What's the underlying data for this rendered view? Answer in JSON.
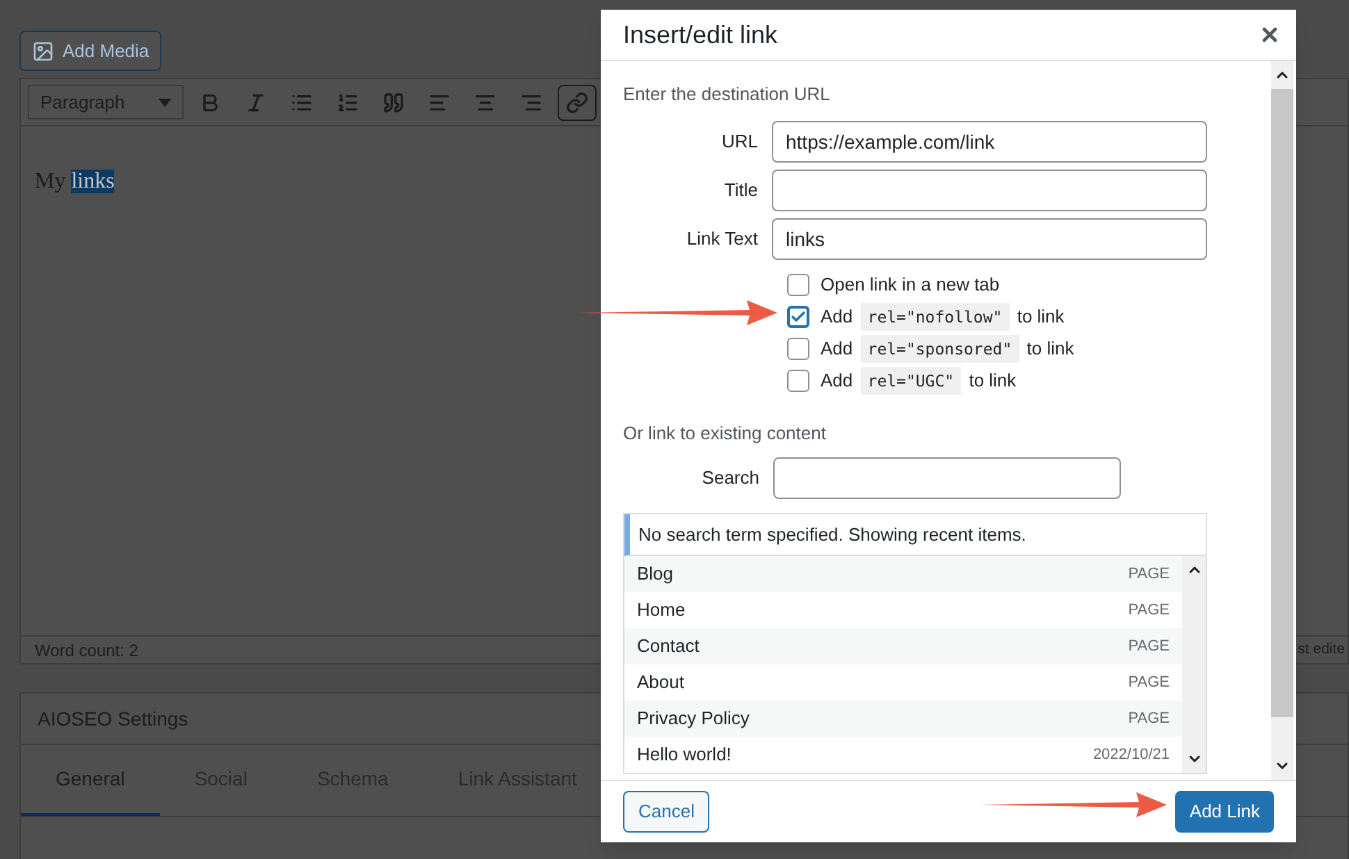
{
  "editor": {
    "add_media": "Add Media",
    "format_select": "Paragraph",
    "toolbar": [
      {
        "kind": "bold",
        "selected": false
      },
      {
        "kind": "italic",
        "selected": false
      },
      {
        "kind": "bullets",
        "selected": false
      },
      {
        "kind": "numbers",
        "selected": false
      },
      {
        "kind": "quote",
        "selected": false
      },
      {
        "kind": "align-left",
        "selected": false
      },
      {
        "kind": "align-center",
        "selected": false
      },
      {
        "kind": "align-right",
        "selected": false
      },
      {
        "kind": "link",
        "selected": true
      }
    ],
    "content_text": "My",
    "selected_text": "links",
    "word_count": "Word count: 2",
    "status_right": "st edite"
  },
  "aioseo": {
    "title": "AIOSEO Settings",
    "tabs": [
      {
        "label": "General",
        "selected": true
      },
      {
        "label": "Social",
        "selected": false
      },
      {
        "label": "Schema",
        "selected": false
      },
      {
        "label": "Link Assistant",
        "selected": false
      }
    ]
  },
  "dialog": {
    "title": "Insert/edit link",
    "intro": "Enter the destination URL",
    "fields": [
      {
        "label": "URL",
        "value": "https://example.com/link"
      },
      {
        "label": "Title"
      },
      {
        "label": "Link Text",
        "value": "links"
      }
    ],
    "options": [
      {
        "kind": "plain",
        "text": "Open link in a new tab",
        "checked": false
      },
      {
        "kind": "rel",
        "before": "Add",
        "code": "rel=\"nofollow\"",
        "after": "to link",
        "checked": true
      },
      {
        "kind": "rel",
        "before": "Add",
        "code": "rel=\"sponsored\"",
        "after": "to link",
        "checked": false
      },
      {
        "kind": "rel",
        "before": "Add",
        "code": "rel=\"UGC\"",
        "after": "to link",
        "checked": false
      }
    ],
    "existing_heading": "Or link to existing content",
    "search_label": "Search",
    "notice": "No search term specified. Showing recent items.",
    "results": [
      {
        "title": "Blog",
        "info": "PAGE"
      },
      {
        "title": "Home",
        "info": "PAGE"
      },
      {
        "title": "Contact",
        "info": "PAGE"
      },
      {
        "title": "About",
        "info": "PAGE"
      },
      {
        "title": "Privacy Policy",
        "info": "PAGE"
      },
      {
        "title": "Hello world!",
        "info": "2022/10/21"
      }
    ],
    "cancel": "Cancel",
    "submit": "Add Link"
  }
}
